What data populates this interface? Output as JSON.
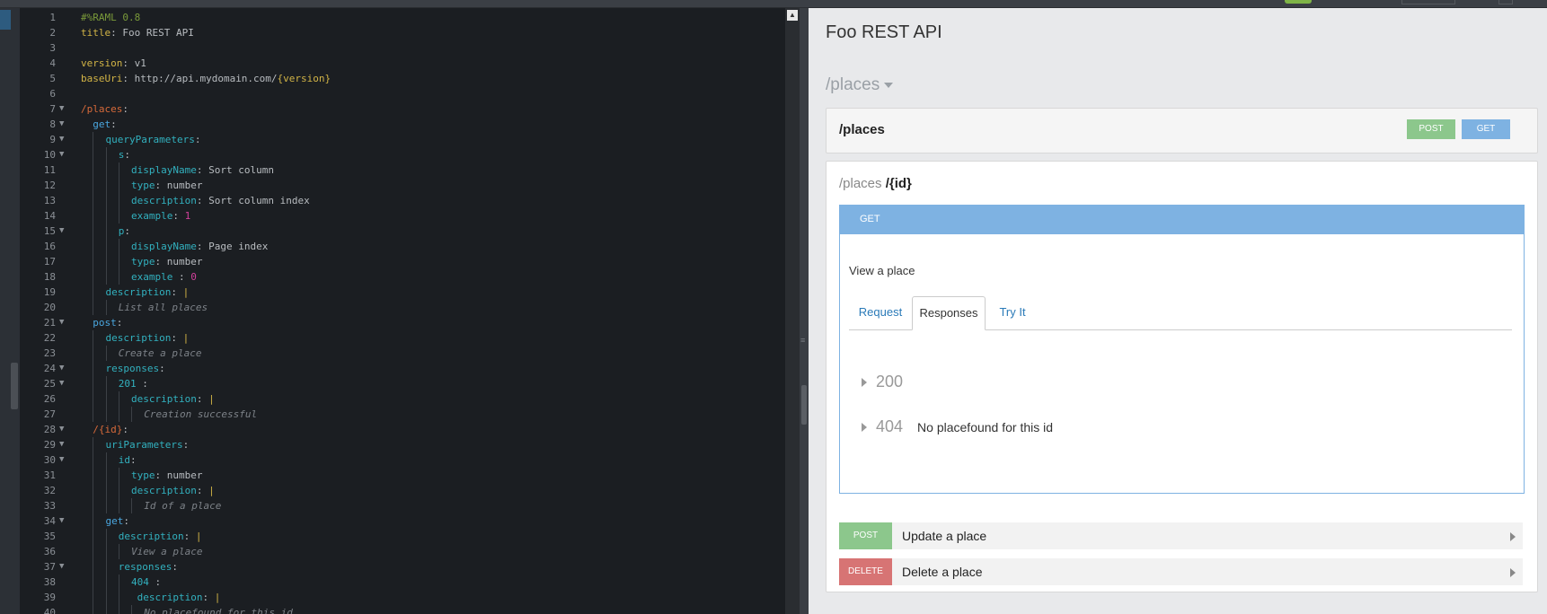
{
  "editor": {
    "lines": [
      {
        "n": "1",
        "fold": false,
        "indent": 0,
        "parts": [
          {
            "t": "#%RAML 0.8",
            "c": "tok-com"
          }
        ]
      },
      {
        "n": "2",
        "fold": false,
        "indent": 0,
        "parts": [
          {
            "t": "title",
            "c": "tok-key"
          },
          {
            "t": ": Foo REST API",
            "c": "tok-txt"
          }
        ]
      },
      {
        "n": "3",
        "fold": false,
        "indent": 0,
        "parts": []
      },
      {
        "n": "4",
        "fold": false,
        "indent": 0,
        "parts": [
          {
            "t": "version",
            "c": "tok-key"
          },
          {
            "t": ": v1",
            "c": "tok-txt"
          }
        ]
      },
      {
        "n": "5",
        "fold": false,
        "indent": 0,
        "parts": [
          {
            "t": "baseUri",
            "c": "tok-key"
          },
          {
            "t": ": http://api.mydomain.com/",
            "c": "tok-txt"
          },
          {
            "t": "{version}",
            "c": "tok-key"
          }
        ]
      },
      {
        "n": "6",
        "fold": false,
        "indent": 0,
        "parts": []
      },
      {
        "n": "7",
        "fold": true,
        "indent": 0,
        "parts": [
          {
            "t": "/places",
            "c": "tok-red"
          },
          {
            "t": ":",
            "c": "tok-txt"
          }
        ]
      },
      {
        "n": "8",
        "fold": true,
        "indent": 1,
        "parts": [
          {
            "t": "get",
            "c": "tok-blue"
          },
          {
            "t": ":",
            "c": "tok-txt"
          }
        ]
      },
      {
        "n": "9",
        "fold": true,
        "indent": 2,
        "parts": [
          {
            "t": "queryParameters",
            "c": "tok-key2"
          },
          {
            "t": ":",
            "c": "tok-txt"
          }
        ]
      },
      {
        "n": "10",
        "fold": true,
        "indent": 3,
        "parts": [
          {
            "t": "s",
            "c": "tok-key2"
          },
          {
            "t": ":",
            "c": "tok-txt"
          }
        ]
      },
      {
        "n": "11",
        "fold": false,
        "indent": 4,
        "parts": [
          {
            "t": "displayName",
            "c": "tok-key2"
          },
          {
            "t": ": Sort column",
            "c": "tok-txt"
          }
        ]
      },
      {
        "n": "12",
        "fold": false,
        "indent": 4,
        "parts": [
          {
            "t": "type",
            "c": "tok-key2"
          },
          {
            "t": ": number",
            "c": "tok-txt"
          }
        ]
      },
      {
        "n": "13",
        "fold": false,
        "indent": 4,
        "parts": [
          {
            "t": "description",
            "c": "tok-key2"
          },
          {
            "t": ": Sort column index",
            "c": "tok-txt"
          }
        ]
      },
      {
        "n": "14",
        "fold": false,
        "indent": 4,
        "parts": [
          {
            "t": "example",
            "c": "tok-key2"
          },
          {
            "t": ": ",
            "c": "tok-txt"
          },
          {
            "t": "1",
            "c": "tok-num"
          }
        ]
      },
      {
        "n": "15",
        "fold": true,
        "indent": 3,
        "parts": [
          {
            "t": "p",
            "c": "tok-key2"
          },
          {
            "t": ":",
            "c": "tok-txt"
          }
        ]
      },
      {
        "n": "16",
        "fold": false,
        "indent": 4,
        "parts": [
          {
            "t": "displayName",
            "c": "tok-key2"
          },
          {
            "t": ": Page index",
            "c": "tok-txt"
          }
        ]
      },
      {
        "n": "17",
        "fold": false,
        "indent": 4,
        "parts": [
          {
            "t": "type",
            "c": "tok-key2"
          },
          {
            "t": ": number",
            "c": "tok-txt"
          }
        ]
      },
      {
        "n": "18",
        "fold": false,
        "indent": 4,
        "parts": [
          {
            "t": "example",
            "c": "tok-key2"
          },
          {
            "t": " : ",
            "c": "tok-txt"
          },
          {
            "t": "0",
            "c": "tok-num"
          }
        ]
      },
      {
        "n": "19",
        "fold": false,
        "indent": 2,
        "parts": [
          {
            "t": "description",
            "c": "tok-key2"
          },
          {
            "t": ": ",
            "c": "tok-txt"
          },
          {
            "t": "|",
            "c": "tok-key"
          }
        ]
      },
      {
        "n": "20",
        "fold": false,
        "indent": 3,
        "parts": [
          {
            "t": "List all places",
            "c": "tok-it"
          }
        ]
      },
      {
        "n": "21",
        "fold": true,
        "indent": 1,
        "parts": [
          {
            "t": "post",
            "c": "tok-blue"
          },
          {
            "t": ":",
            "c": "tok-txt"
          }
        ]
      },
      {
        "n": "22",
        "fold": false,
        "indent": 2,
        "parts": [
          {
            "t": "description",
            "c": "tok-key2"
          },
          {
            "t": ": ",
            "c": "tok-txt"
          },
          {
            "t": "|",
            "c": "tok-key"
          }
        ]
      },
      {
        "n": "23",
        "fold": false,
        "indent": 3,
        "parts": [
          {
            "t": "Create a place",
            "c": "tok-it"
          }
        ]
      },
      {
        "n": "24",
        "fold": true,
        "indent": 2,
        "parts": [
          {
            "t": "responses",
            "c": "tok-key2"
          },
          {
            "t": ":",
            "c": "tok-txt"
          }
        ]
      },
      {
        "n": "25",
        "fold": true,
        "indent": 3,
        "parts": [
          {
            "t": "201",
            "c": "tok-key2"
          },
          {
            "t": " :",
            "c": "tok-txt"
          }
        ]
      },
      {
        "n": "26",
        "fold": false,
        "indent": 4,
        "parts": [
          {
            "t": "description",
            "c": "tok-key2"
          },
          {
            "t": ": ",
            "c": "tok-txt"
          },
          {
            "t": "|",
            "c": "tok-key"
          }
        ]
      },
      {
        "n": "27",
        "fold": false,
        "indent": 5,
        "parts": [
          {
            "t": "Creation successful",
            "c": "tok-it"
          }
        ]
      },
      {
        "n": "28",
        "fold": true,
        "indent": 1,
        "parts": [
          {
            "t": "/{id}",
            "c": "tok-red"
          },
          {
            "t": ":",
            "c": "tok-txt"
          }
        ]
      },
      {
        "n": "29",
        "fold": true,
        "indent": 2,
        "parts": [
          {
            "t": "uriParameters",
            "c": "tok-key2"
          },
          {
            "t": ":",
            "c": "tok-txt"
          }
        ]
      },
      {
        "n": "30",
        "fold": true,
        "indent": 3,
        "parts": [
          {
            "t": "id",
            "c": "tok-key2"
          },
          {
            "t": ":",
            "c": "tok-txt"
          }
        ]
      },
      {
        "n": "31",
        "fold": false,
        "indent": 4,
        "parts": [
          {
            "t": "type",
            "c": "tok-key2"
          },
          {
            "t": ": number",
            "c": "tok-txt"
          }
        ]
      },
      {
        "n": "32",
        "fold": false,
        "indent": 4,
        "parts": [
          {
            "t": "description",
            "c": "tok-key2"
          },
          {
            "t": ": ",
            "c": "tok-txt"
          },
          {
            "t": "|",
            "c": "tok-key"
          }
        ]
      },
      {
        "n": "33",
        "fold": false,
        "indent": 5,
        "parts": [
          {
            "t": "Id of a place",
            "c": "tok-it"
          }
        ]
      },
      {
        "n": "34",
        "fold": true,
        "indent": 2,
        "parts": [
          {
            "t": "get",
            "c": "tok-blue"
          },
          {
            "t": ":",
            "c": "tok-txt"
          }
        ]
      },
      {
        "n": "35",
        "fold": false,
        "indent": 3,
        "parts": [
          {
            "t": "description",
            "c": "tok-key2"
          },
          {
            "t": ": ",
            "c": "tok-txt"
          },
          {
            "t": "|",
            "c": "tok-key"
          }
        ]
      },
      {
        "n": "36",
        "fold": false,
        "indent": 4,
        "parts": [
          {
            "t": "View a place",
            "c": "tok-it"
          }
        ]
      },
      {
        "n": "37",
        "fold": true,
        "indent": 3,
        "parts": [
          {
            "t": "responses",
            "c": "tok-key2"
          },
          {
            "t": ":",
            "c": "tok-txt"
          }
        ]
      },
      {
        "n": "38",
        "fold": false,
        "indent": 4,
        "parts": [
          {
            "t": "404",
            "c": "tok-key2"
          },
          {
            "t": " :",
            "c": "tok-txt"
          }
        ]
      },
      {
        "n": "39",
        "fold": false,
        "indent": 4,
        "parts": [
          {
            "t": " description",
            "c": "tok-key2"
          },
          {
            "t": ": ",
            "c": "tok-txt"
          },
          {
            "t": "|",
            "c": "tok-key"
          }
        ]
      },
      {
        "n": "40",
        "fold": false,
        "indent": 5,
        "parts": [
          {
            "t": "No placefound for this id",
            "c": "tok-it"
          }
        ]
      }
    ]
  },
  "console": {
    "api_title": "Foo REST API",
    "group_label": "/places",
    "resource": {
      "path": "/places",
      "methods": [
        {
          "label": "POST",
          "kind": "post"
        },
        {
          "label": "GET",
          "kind": "get"
        }
      ]
    },
    "subresource": {
      "parent": "/places",
      "child": "/{id}",
      "method_label": "GET",
      "description": "View a place",
      "tabs": [
        {
          "label": "Request",
          "active": false
        },
        {
          "label": "Responses",
          "active": true
        },
        {
          "label": "Try It",
          "active": false
        }
      ],
      "responses": [
        {
          "code": "200",
          "description": ""
        },
        {
          "code": "404",
          "description": "No placefound for this id"
        }
      ],
      "actions": [
        {
          "method": "POST",
          "kind": "post",
          "label": "Update a place"
        },
        {
          "method": "DELETE",
          "kind": "del",
          "label": "Delete a place"
        }
      ]
    }
  },
  "colors": {
    "get": "#7eb2e2",
    "post": "#8cc78c",
    "delete": "#d77474",
    "editor_bg": "#1b1e22",
    "panel_bg": "#e8e9eb"
  }
}
